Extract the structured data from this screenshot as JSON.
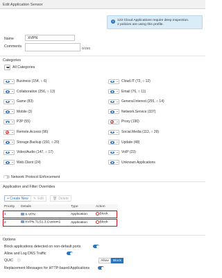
{
  "window": {
    "title": "Edit Application Sensor"
  },
  "info": {
    "line1": "122 Cloud Applications require deep inspection.",
    "line2": "2 policies are using this profile."
  },
  "form": {
    "name_label": "Name",
    "name_value": "XVPN",
    "comments_label": "Comments",
    "comments_value": "",
    "comments_counter": "0/255"
  },
  "categories": {
    "title": "Categories",
    "all_label": "All Categories",
    "left": [
      {
        "label": "Business (154, ○ 6)",
        "action": "monitor"
      },
      {
        "label": "Collaboration (256, ○ 13)",
        "action": "monitor"
      },
      {
        "label": "Game (83)",
        "action": "monitor"
      },
      {
        "label": "Mobile (3)",
        "action": "monitor"
      },
      {
        "label": "P2P (55)",
        "action": "monitor"
      },
      {
        "label": "Remote.Access (96)",
        "action": "block"
      },
      {
        "label": "Storage.Backup (150, ○ 20)",
        "action": "monitor"
      },
      {
        "label": "Video/Audio (147, ○ 17)",
        "action": "monitor"
      },
      {
        "label": "Web.Client (24)",
        "action": "monitor"
      }
    ],
    "right": [
      {
        "label": "Cloud.IT (72, ○ 12)",
        "action": "monitor"
      },
      {
        "label": "Email (76, ○ 11)",
        "action": "monitor"
      },
      {
        "label": "General.Interest (255, ○ 14)",
        "action": "monitor"
      },
      {
        "label": "Network.Service (337)",
        "action": "monitor"
      },
      {
        "label": "Proxy (190)",
        "action": "block"
      },
      {
        "label": "Social.Media (113, ○ 29)",
        "action": "monitor"
      },
      {
        "label": "Update (48)",
        "action": "monitor"
      },
      {
        "label": "VoIP (23)",
        "action": "monitor"
      },
      {
        "label": "Unknown Applications",
        "action": "monitor"
      }
    ]
  },
  "network_protocol": {
    "label": "Network Protocol Enforcement",
    "enabled": false
  },
  "overrides": {
    "title": "Application and Filter Overrides",
    "create_label": "+ Create New",
    "edit_label": "Edit",
    "delete_label": "Delete",
    "columns": [
      "Priority",
      "Details",
      "Type",
      "Action"
    ],
    "rows": [
      {
        "priority": "1",
        "details": "X-VPN",
        "type": "Application",
        "action": "Block"
      },
      {
        "priority": "2",
        "details": "XVPN.TLS1.3.Custom1",
        "type": "Application",
        "action": "Block"
      }
    ]
  },
  "options": {
    "title": "Options",
    "nondefault_label": "Block applications detected on non-default ports",
    "nondefault_on": true,
    "dns_label": "Allow and Log DNS Traffic",
    "dns_on": true,
    "quic_label": "QUIC",
    "quic_allow": "Allow",
    "quic_block": "Block",
    "replacement_label": "Replacement Messages for HTTP-based Applications",
    "replacement_on": true
  },
  "colors": {
    "accent": "#2c73b8",
    "danger": "#d30d22",
    "info_bg": "#d9ecf8"
  }
}
